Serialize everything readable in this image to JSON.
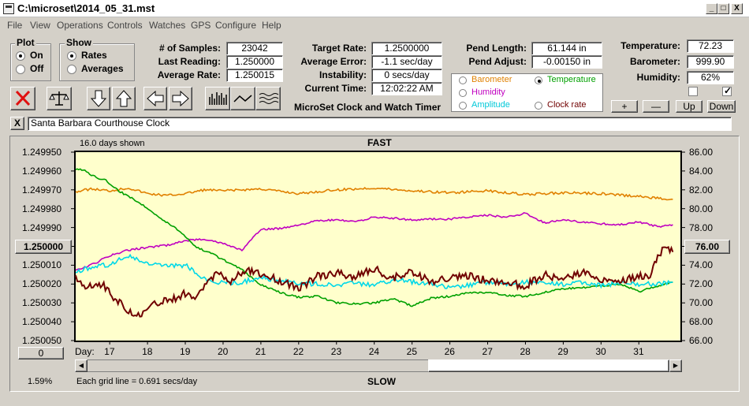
{
  "window": {
    "title": "C:\\microset\\2014_05_31.mst",
    "min": "_",
    "max": "□",
    "close": "X"
  },
  "menu": [
    "File",
    "View",
    "Operations",
    "Controls",
    "Watches",
    "GPS",
    "Configure",
    "Help"
  ],
  "plot": {
    "label": "Plot",
    "on": "On",
    "off": "Off",
    "selected": "On"
  },
  "show": {
    "label": "Show",
    "rates": "Rates",
    "averages": "Averages",
    "selected": "Rates"
  },
  "stats": {
    "samples_label": "# of Samples:",
    "samples": "23042",
    "last_label": "Last Reading:",
    "last": "1.250000",
    "avg_label": "Average Rate:",
    "avg": "1.250015",
    "target_label": "Target Rate:",
    "target": "1.2500000",
    "err_label": "Average Error:",
    "err": "-1.1 sec/day",
    "inst_label": "Instability:",
    "inst": "0 secs/day",
    "time_label": "Current Time:",
    "time": "12:02:22 AM",
    "app_name": "MicroSet Clock and Watch Timer",
    "plen_label": "Pend Length:",
    "plen": "61.144 in",
    "padj_label": "Pend Adjust:",
    "padj": "-0.00150 in",
    "temp_label": "Temperature:",
    "temp": "72.23",
    "baro_label": "Barometer:",
    "baro": "999.90",
    "hum_label": "Humidity:",
    "hum": "62%"
  },
  "legend": {
    "barometer": "Barometer",
    "temperature": "Temperature",
    "humidity": "Humidity",
    "amplitude": "Amplitude",
    "clock_rate": "Clock rate",
    "selected": "Temperature"
  },
  "colors": {
    "barometer": "#e08000",
    "temperature": "#00a000",
    "humidity": "#c000c0",
    "amplitude": "#00d8e8",
    "clock_rate": "#700000",
    "plot_bg": "#ffffcc"
  },
  "scale_buttons": {
    "plus": "+",
    "minus": "—",
    "up": "Up",
    "down": "Down"
  },
  "clock_name": "Santa Barbara Courthouse Clock",
  "close_label": "X",
  "chart_data": {
    "type": "line",
    "title": "FAST",
    "bottom_title": "SLOW",
    "days_shown": "16.0 days shown",
    "grid_note": "Each grid line = 0.691 secs/day",
    "percent": "1.59%",
    "day_label": "Day:",
    "x_ticks": [
      "17",
      "18",
      "19",
      "20",
      "21",
      "22",
      "23",
      "24",
      "25",
      "26",
      "27",
      "28",
      "29",
      "30",
      "31"
    ],
    "x_range": [
      16.1,
      32.1
    ],
    "left_ticks": [
      "1.249950",
      "1.249960",
      "1.249970",
      "1.249980",
      "1.249990",
      "1.250000",
      "1.250010",
      "1.250020",
      "1.250030",
      "1.250040",
      "1.250050"
    ],
    "right_ticks": [
      "86.00",
      "84.00",
      "82.00",
      "80.00",
      "78.00",
      "76.00",
      "74.00",
      "72.00",
      "70.00",
      "68.00",
      "66.00"
    ],
    "left_range": [
      1.24995,
      1.25005
    ],
    "right_range": [
      66,
      86
    ],
    "center_left": "1.250000",
    "center_right": "76.00",
    "left_offset_label": "0",
    "series": [
      {
        "key": "barometer",
        "x": [
          16.1,
          16.5,
          17,
          17.5,
          18,
          18.5,
          19,
          19.5,
          20,
          21,
          22,
          23,
          24,
          25,
          26,
          27,
          28,
          29,
          30,
          31,
          31.9
        ],
        "y": [
          81.8,
          82.1,
          81.9,
          82.2,
          81.6,
          81.4,
          81.6,
          82.0,
          81.9,
          82.1,
          81.6,
          82.0,
          82.2,
          81.9,
          81.7,
          81.9,
          81.5,
          81.7,
          81.6,
          81.3,
          81.0
        ]
      },
      {
        "key": "temperature",
        "x": [
          16.1,
          16.3,
          16.6,
          16.9,
          17.2,
          17.5,
          17.8,
          18.1,
          18.4,
          18.7,
          19,
          19.3,
          19.6,
          20,
          20.5,
          21,
          21.5,
          22,
          22.5,
          23,
          23.5,
          24,
          24.5,
          25,
          25.5,
          26,
          26.5,
          27,
          27.5,
          28,
          28.5,
          29,
          29.5,
          30,
          30.5,
          31,
          31.5,
          31.9
        ],
        "y": [
          84.2,
          84.1,
          83.4,
          83.0,
          82.0,
          81.3,
          80.6,
          79.8,
          78.8,
          78.1,
          77.1,
          75.9,
          75.4,
          74.6,
          73.5,
          71.9,
          71.1,
          70.6,
          70.7,
          70.0,
          69.9,
          70.0,
          70.4,
          69.7,
          70.5,
          70.7,
          71.1,
          71.1,
          70.8,
          70.7,
          71.1,
          71.5,
          71.6,
          71.8,
          72.0,
          71.2,
          71.8,
          72.2
        ]
      },
      {
        "key": "humidity",
        "x": [
          16.1,
          16.5,
          17,
          17.5,
          18,
          18.5,
          19,
          19.5,
          20,
          20.5,
          21,
          21.5,
          22,
          22.5,
          23,
          23.5,
          24,
          24.5,
          25,
          25.5,
          26,
          26.5,
          27,
          27.5,
          28,
          28.5,
          29,
          29.5,
          30,
          30.5,
          31,
          31.5,
          31.9
        ],
        "y": [
          73.4,
          74.0,
          75.0,
          75.6,
          75.9,
          76.1,
          76.6,
          76.8,
          76.3,
          75.6,
          77.8,
          77.9,
          78.3,
          78.7,
          78.8,
          78.6,
          79.1,
          79.0,
          78.8,
          78.9,
          78.9,
          79.1,
          79.3,
          79.1,
          79.5,
          78.5,
          78.8,
          78.6,
          78.4,
          78.3,
          78.6,
          78.1,
          78.3
        ]
      },
      {
        "key": "amplitude",
        "x": [
          16.1,
          16.5,
          17,
          17.5,
          18,
          18.5,
          19,
          19.5,
          20,
          20.5,
          21,
          21.5,
          22,
          22.5,
          23,
          23.5,
          24,
          24.5,
          25,
          25.5,
          26,
          26.5,
          27,
          27.5,
          28,
          28.5,
          29,
          29.5,
          30,
          30.5,
          31,
          31.5,
          31.9
        ],
        "y": [
          73.2,
          73.8,
          74.1,
          75.0,
          74.1,
          73.9,
          74.0,
          72.5,
          72.1,
          72.2,
          72.7,
          72.3,
          72.1,
          72.0,
          71.9,
          72.1,
          71.9,
          72.5,
          72.2,
          72.1,
          71.6,
          71.9,
          72.2,
          72.0,
          72.2,
          72.1,
          72.0,
          72.2,
          71.9,
          72.1,
          72.0,
          72.0,
          72.2
        ]
      },
      {
        "key": "clock_rate",
        "x": [
          16.1,
          16.4,
          16.8,
          17.1,
          17.5,
          17.8,
          18.1,
          18.4,
          18.7,
          19.0,
          19.3,
          19.6,
          19.9,
          20.2,
          20.6,
          21,
          21.5,
          22,
          22.5,
          23,
          23.5,
          24,
          24.5,
          25,
          25.5,
          26,
          26.5,
          27,
          27.5,
          28,
          28.5,
          29,
          29.5,
          30,
          30.5,
          31,
          31.3,
          31.5,
          31.7,
          31.9
        ],
        "y": [
          1.250017,
          1.250021,
          1.25002,
          1.250027,
          1.250034,
          1.250037,
          1.250032,
          1.250029,
          1.250028,
          1.250025,
          1.250028,
          1.250018,
          1.250013,
          1.250019,
          1.250012,
          1.250015,
          1.250018,
          1.250022,
          1.250016,
          1.250014,
          1.250016,
          1.250012,
          1.250017,
          1.250013,
          1.250019,
          1.250017,
          1.250016,
          1.250018,
          1.250019,
          1.250021,
          1.250015,
          1.250018,
          1.250014,
          1.250017,
          1.250018,
          1.250016,
          1.250015,
          1.250006,
          1.249999,
          1.250003
        ]
      }
    ]
  },
  "scrollbar": {
    "left_arrow": "◀",
    "right_arrow": "▶"
  }
}
